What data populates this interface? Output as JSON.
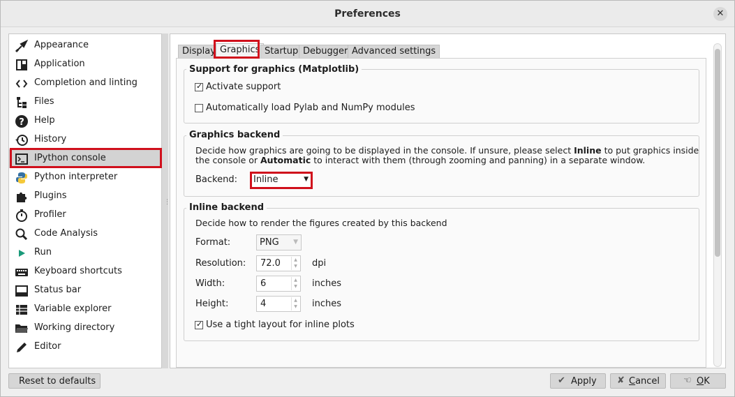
{
  "window": {
    "title": "Preferences",
    "close_glyph": "✕"
  },
  "sidebar": {
    "items": [
      {
        "label": "Appearance",
        "icon": "paintbrush-icon"
      },
      {
        "label": "Application",
        "icon": "layout-icon"
      },
      {
        "label": "Completion and linting",
        "icon": "code-brackets-icon"
      },
      {
        "label": "Files",
        "icon": "file-tree-icon"
      },
      {
        "label": "Help",
        "icon": "question-icon"
      },
      {
        "label": "History",
        "icon": "history-icon"
      },
      {
        "label": "IPython console",
        "icon": "console-icon",
        "selected": true
      },
      {
        "label": "Python interpreter",
        "icon": "python-icon"
      },
      {
        "label": "Plugins",
        "icon": "puzzle-icon"
      },
      {
        "label": "Profiler",
        "icon": "stopwatch-icon"
      },
      {
        "label": "Code Analysis",
        "icon": "magnifier-icon"
      },
      {
        "label": "Run",
        "icon": "play-icon"
      },
      {
        "label": "Keyboard shortcuts",
        "icon": "keyboard-icon"
      },
      {
        "label": "Status bar",
        "icon": "status-bar-icon"
      },
      {
        "label": "Variable explorer",
        "icon": "table-icon"
      },
      {
        "label": "Working directory",
        "icon": "folder-icon"
      },
      {
        "label": "Editor",
        "icon": "pencil-icon"
      }
    ]
  },
  "tabs": [
    {
      "label": "Display"
    },
    {
      "label": "Graphics",
      "active": true
    },
    {
      "label": "Startup"
    },
    {
      "label": "Debugger"
    },
    {
      "label": "Advanced settings"
    }
  ],
  "support_group": {
    "title": "Support for graphics (Matplotlib)",
    "activate_label": "Activate support",
    "activate_checked": true,
    "autoload_label": "Automatically load Pylab and NumPy modules",
    "autoload_checked": false
  },
  "backend_group": {
    "title": "Graphics backend",
    "desc_part1": "Decide how graphics are going to be displayed in the console. If unsure, please select ",
    "desc_bold1": "Inline",
    "desc_part2": " to put graphics inside",
    "desc_part3": "the console or ",
    "desc_bold2": "Automatic",
    "desc_part4": " to interact with them (through zooming and panning) in a separate window.",
    "backend_label": "Backend:",
    "backend_value": "Inline"
  },
  "inline_group": {
    "title": "Inline backend",
    "description": "Decide how to render the figures created by this backend",
    "format_label": "Format:",
    "format_value": "PNG",
    "resolution_label": "Resolution:",
    "resolution_value": "72.0",
    "resolution_unit": "dpi",
    "width_label": "Width:",
    "width_value": "6",
    "width_unit": "inches",
    "height_label": "Height:",
    "height_value": "4",
    "height_unit": "inches",
    "tight_label": "Use a tight layout for inline plots",
    "tight_checked": true
  },
  "footer": {
    "reset_label": "Reset to defaults",
    "apply_label": "Apply",
    "cancel_first": "C",
    "cancel_rest": "ancel",
    "ok_first": "O",
    "ok_rest": "K"
  },
  "colors": {
    "highlight": "#d0101c",
    "python_blue": "#3672a4",
    "python_yellow": "#f5c93b",
    "run_green": "#1a9a7a"
  }
}
